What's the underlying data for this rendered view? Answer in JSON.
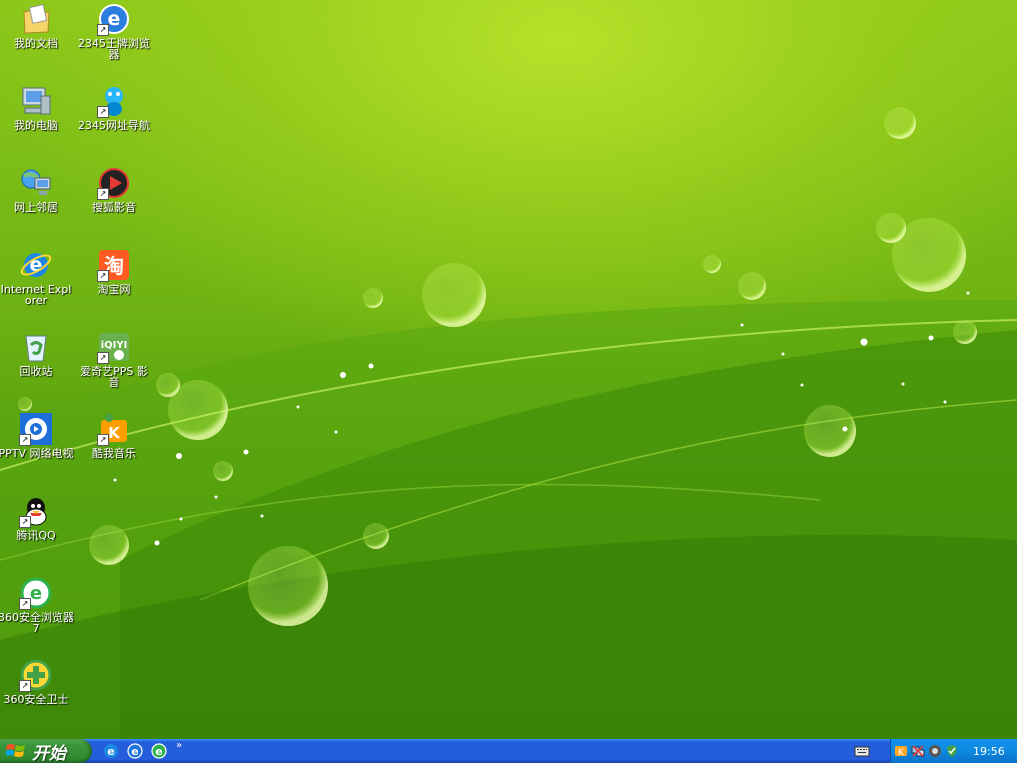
{
  "desktop": {
    "icons": [
      {
        "label": "我的文档",
        "icon": "my-documents-icon"
      },
      {
        "label": "2345王牌浏览器",
        "icon": "browser-2345-icon"
      },
      {
        "label": "我的电脑",
        "icon": "my-computer-icon"
      },
      {
        "label": "2345网址导航",
        "icon": "nav-2345-icon"
      },
      {
        "label": "网上邻居",
        "icon": "network-places-icon"
      },
      {
        "label": "搜狐影音",
        "icon": "sohu-video-icon"
      },
      {
        "label": "Internet Explorer",
        "icon": "internet-explorer-icon"
      },
      {
        "label": "淘宝网",
        "icon": "taobao-icon"
      },
      {
        "label": "回收站",
        "icon": "recycle-bin-icon"
      },
      {
        "label": "爱奇艺PPS 影音",
        "icon": "iqiyi-icon"
      },
      {
        "label": "PPTV 网络电视",
        "icon": "pptv-icon"
      },
      {
        "label": "酷我音乐",
        "icon": "kuwo-music-icon"
      },
      {
        "label": "腾讯QQ",
        "icon": "tencent-qq-icon"
      },
      {
        "label": "360安全浏览器7",
        "icon": "browser-360-icon"
      },
      {
        "label": "360安全卫士",
        "icon": "security-360-icon"
      }
    ]
  },
  "taskbar": {
    "start_label": "开始",
    "quick_launch": [
      "ie-quicklaunch-icon",
      "browser-quicklaunch-icon",
      "browser-360-quicklaunch-icon"
    ],
    "more_label": "»",
    "tray_icons": [
      "kuwo-tray-icon",
      "network-tray-icon",
      "volume-tray-icon",
      "security-tray-icon"
    ],
    "clock": "19:56"
  }
}
